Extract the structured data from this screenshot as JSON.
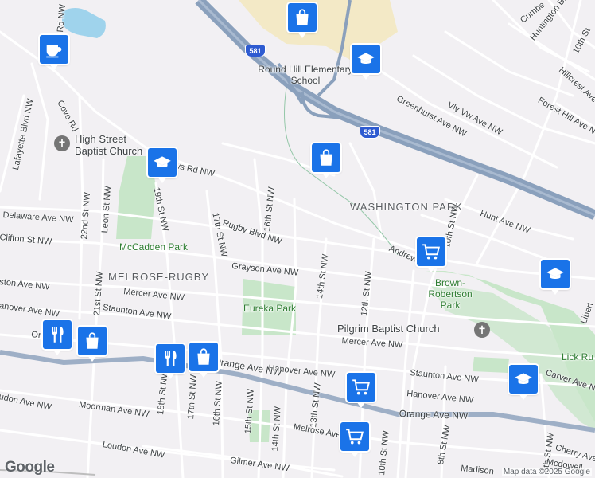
{
  "map": {
    "colors": {
      "background": "#f2f0f3",
      "park": "#c8e6c9",
      "school_area": "#f3e9c6",
      "water": "#9fd3ec",
      "highway": "#8aa0bc",
      "road": "#ffffff",
      "poi_pin": "#1a73e8",
      "restaurant_pin": "#1a73e8"
    },
    "places": [
      {
        "id": "washington-park",
        "text": "WASHINGTON PARK"
      },
      {
        "id": "melrose-rugby",
        "text": "MELROSE-RUGBY"
      }
    ],
    "parks": [
      {
        "id": "mccadden-park",
        "text": "McCadden Park"
      },
      {
        "id": "eureka-park",
        "text": "Eureka Park"
      },
      {
        "id": "brown-robertson-park",
        "text": "Brown-Robertson Park"
      },
      {
        "id": "lick-run",
        "text": "Lick Ru"
      }
    ],
    "pois": [
      {
        "id": "high-street-baptist",
        "text": "High Street Baptist Church"
      },
      {
        "id": "pilgrim-baptist",
        "text": "Pilgrim Baptist Church"
      },
      {
        "id": "round-hill-school",
        "text": "Round Hill Elementary School"
      }
    ],
    "highway_shields": [
      {
        "id": "shield-581-top",
        "text": "581"
      },
      {
        "id": "shield-581-mid",
        "text": "581"
      }
    ],
    "streets": [
      {
        "id": "lafayette-blvd",
        "text": "Lafayette Blvd NW"
      },
      {
        "id": "cove-rd",
        "text": "Cove Rd"
      },
      {
        "id": "rd-nw-top",
        "text": "Rd NW"
      },
      {
        "id": "ws-rd",
        "text": "ws Rd NW"
      },
      {
        "id": "delaware-ave",
        "text": "Delaware Ave NW"
      },
      {
        "id": "clifton-st",
        "text": "Clifton St NW"
      },
      {
        "id": "22nd-st",
        "text": "22nd St NW"
      },
      {
        "id": "leon-st",
        "text": "Leon St NW"
      },
      {
        "id": "19th-st-a",
        "text": "19th St NW"
      },
      {
        "id": "17th-st-a",
        "text": "17th St NW"
      },
      {
        "id": "16th-st-a",
        "text": "16th St NW"
      },
      {
        "id": "rugby-blvd",
        "text": "Rugby Blvd NW"
      },
      {
        "id": "grayson-ave",
        "text": "Grayson Ave NW"
      },
      {
        "id": "14th-st-a",
        "text": "14th St NW"
      },
      {
        "id": "12th-st-a",
        "text": "12th St NW"
      },
      {
        "id": "10th-st-a",
        "text": "10th St NW"
      },
      {
        "id": "andrews",
        "text": "Andrews"
      },
      {
        "id": "hunt-ave",
        "text": "Hunt Ave NW"
      },
      {
        "id": "greenhurst-ave",
        "text": "Greenhurst Ave NW"
      },
      {
        "id": "vly-vw-ave",
        "text": "Vly Vw Ave NW"
      },
      {
        "id": "forest-hill-ave",
        "text": "Forest Hill Ave NW"
      },
      {
        "id": "hillcrest-ave",
        "text": "Hillcrest Ave"
      },
      {
        "id": "huntington-blvd",
        "text": "Huntington Blvd"
      },
      {
        "id": "cumberland",
        "text": "Cumbe"
      },
      {
        "id": "10th-st-top",
        "text": "10th St"
      },
      {
        "id": "liberty",
        "text": "Libert"
      },
      {
        "id": "21st-st",
        "text": "21st St NW"
      },
      {
        "id": "mercer-ave-w",
        "text": "Mercer Ave NW"
      },
      {
        "id": "staunton-ave-w",
        "text": "Staunton Ave NW"
      },
      {
        "id": "hanover-ave-w",
        "text": "anover Ave NW"
      },
      {
        "id": "ston-ave",
        "text": "ston Ave NW"
      },
      {
        "id": "mercer-ave-e",
        "text": "Mercer Ave NW"
      },
      {
        "id": "hanover-ave-c",
        "text": "Hanover Ave NW"
      },
      {
        "id": "staunton-ave-e",
        "text": "Staunton Ave NW"
      },
      {
        "id": "hanover-ave-e",
        "text": "Hanover Ave NW"
      },
      {
        "id": "carver-ave",
        "text": "Carver Ave N"
      },
      {
        "id": "orange-ave-c",
        "text": "Orange Ave NW"
      },
      {
        "id": "orange-ave-e",
        "text": "Orange Ave NW"
      },
      {
        "id": "orange-ave-w",
        "text": "Or"
      },
      {
        "id": "18th-st",
        "text": "18th St NW"
      },
      {
        "id": "17th-st-b",
        "text": "17th St NW"
      },
      {
        "id": "16th-st-b",
        "text": "16th St NW"
      },
      {
        "id": "15th-st",
        "text": "15th St NW"
      },
      {
        "id": "14th-st-b",
        "text": "14th St NW"
      },
      {
        "id": "13th-st",
        "text": "13th St NW"
      },
      {
        "id": "10th-st-b",
        "text": "10th St NW"
      },
      {
        "id": "8th-st",
        "text": "8th St NW"
      },
      {
        "id": "5th-st",
        "text": "5th St NW"
      },
      {
        "id": "moorman-ave",
        "text": "Moorman Ave NW"
      },
      {
        "id": "loudon-ave",
        "text": "Loudon Ave NW"
      },
      {
        "id": "london-ave",
        "text": "udon Ave NW"
      },
      {
        "id": "melrose-ave",
        "text": "Melrose Ave"
      },
      {
        "id": "gilmer-ave",
        "text": "Gilmer Ave NW"
      },
      {
        "id": "madison",
        "text": "Madison"
      },
      {
        "id": "mcdowell",
        "text": "Mcdowell"
      },
      {
        "id": "cherry-ave",
        "text": "Cherry Ave N"
      }
    ],
    "pins": [
      {
        "id": "coffee-pin",
        "icon": "coffee-icon"
      },
      {
        "id": "shopping-pin-top",
        "icon": "shopping-bag-icon"
      },
      {
        "id": "school-pin-roundhill",
        "icon": "graduation-cap-icon"
      },
      {
        "id": "school-pin-highstreet",
        "icon": "graduation-cap-icon"
      },
      {
        "id": "shopping-pin-mid",
        "icon": "shopping-bag-icon"
      },
      {
        "id": "cart-pin-andrews",
        "icon": "shopping-cart-icon"
      },
      {
        "id": "school-pin-east",
        "icon": "graduation-cap-icon"
      },
      {
        "id": "restaurant-pin-west",
        "icon": "fork-knife-icon"
      },
      {
        "id": "shopping-pin-west",
        "icon": "shopping-bag-icon"
      },
      {
        "id": "restaurant-pin-center",
        "icon": "fork-knife-icon"
      },
      {
        "id": "shopping-pin-center",
        "icon": "shopping-bag-icon"
      },
      {
        "id": "cart-pin-staunton",
        "icon": "shopping-cart-icon"
      },
      {
        "id": "cart-pin-melrose",
        "icon": "shopping-cart-icon"
      },
      {
        "id": "school-pin-carver",
        "icon": "graduation-cap-icon"
      }
    ],
    "attribution": "Map data ©2025 Google",
    "logo": "Google"
  }
}
